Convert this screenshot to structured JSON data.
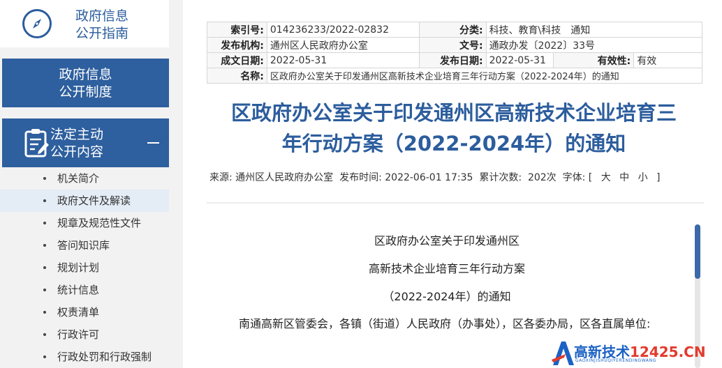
{
  "sidebar": {
    "guide_title_1": "政府信息",
    "guide_title_2": "公开指南",
    "system_title_1": "政府信息",
    "system_title_2": "公开制度",
    "content_title_1": "法定主动",
    "content_title_2": "公开内容",
    "items": [
      {
        "label": "机关简介"
      },
      {
        "label": "政府文件及解读"
      },
      {
        "label": "规章及规范性文件"
      },
      {
        "label": "答问知识库"
      },
      {
        "label": "规划计划"
      },
      {
        "label": "统计信息"
      },
      {
        "label": "权责清单"
      },
      {
        "label": "行政许可"
      },
      {
        "label": "行政处罚和行政强制"
      }
    ],
    "active_index": 1
  },
  "meta": {
    "index_label": "索引号:",
    "index_value": "014236233/2022-02832",
    "category_label": "分类:",
    "category_value": "科技、教育\\科技　通知",
    "publisher_label": "发布机构:",
    "publisher_value": "通州区人民政府办公室",
    "doc_no_label": "文号:",
    "doc_no_value": "通政办发〔2022〕33号",
    "created_label": "成文日期:",
    "created_value": "2022-05-31",
    "published_label": "发布日期:",
    "published_value": "2022-05-31",
    "validity_label": "有效性:",
    "validity_value": "有效",
    "name_label": "名称:",
    "name_value": "区政府办公室关于印发通州区高新技术企业培育三年行动方案（2022-2024年）的通知"
  },
  "article": {
    "title_line1": "区政府办公室关于印发通州区高新技术企业培育三",
    "title_line2": "年行动方案（2022-2024年）的通知",
    "source_label": "来源:",
    "source_value": "通州区人民政府办公室",
    "time_label": "发布时间:",
    "time_value": "2022-06-01 17:35",
    "count_label": "累计次数:",
    "count_value": "202次",
    "font_label": "字体:",
    "font_open": "[",
    "font_large": "大",
    "font_medium": "中",
    "font_small": "小",
    "font_close": "]",
    "body_line1": "区政府办公室关于印发通州区",
    "body_line2": "高新技术企业培育三年行动方案",
    "body_line3": "（2022-2024年）的通知",
    "body_para": "南通高新区管委会，各镇（街道）人民政府（办事处），区各委办局，区各直属单位:"
  },
  "scroll": {
    "position": 0.0
  },
  "watermark": {
    "name": "高新技术",
    "domain": "12425.CN",
    "sub": "GAOXINJISHUQIYERENDINGWANG"
  },
  "colors": {
    "brand_blue": "#2e5f9e",
    "title_blue": "#2c5d9d",
    "watermark_red": "#e23b2e"
  }
}
